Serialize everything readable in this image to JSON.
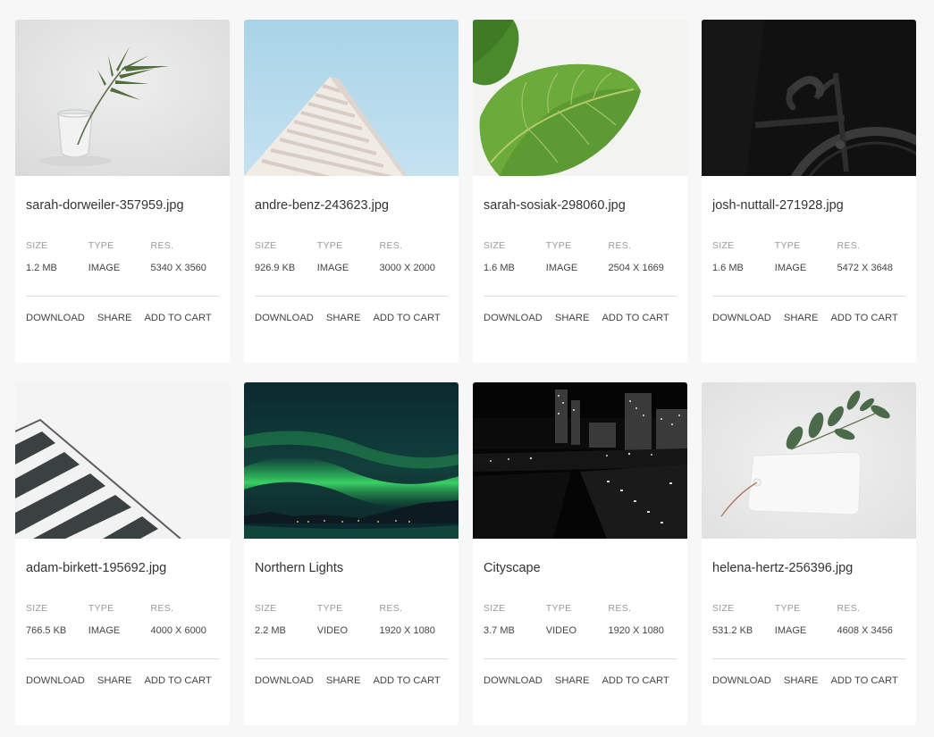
{
  "labels": {
    "size": "SIZE",
    "type": "TYPE",
    "res": "RES."
  },
  "actions": {
    "download": "DOWNLOAD",
    "share": "SHARE",
    "add_to_cart": "ADD TO CART"
  },
  "cards": [
    {
      "title": "sarah-dorweiler-357959.jpg",
      "size": "1.2 MB",
      "type": "IMAGE",
      "res": "5340 X 3560",
      "thumb": "plant-in-glass-photo"
    },
    {
      "title": "andre-benz-243623.jpg",
      "size": "926.9 KB",
      "type": "IMAGE",
      "res": "3000 X 2000",
      "thumb": "white-building-sky-photo"
    },
    {
      "title": "sarah-sosiak-298060.jpg",
      "size": "1.6 MB",
      "type": "IMAGE",
      "res": "2504 X 1669",
      "thumb": "green-leaf-photo"
    },
    {
      "title": "josh-nuttall-271928.jpg",
      "size": "1.6 MB",
      "type": "IMAGE",
      "res": "5472 X 3648",
      "thumb": "black-bicycle-photo"
    },
    {
      "title": "adam-birkett-195692.jpg",
      "size": "766.5 KB",
      "type": "IMAGE",
      "res": "4000 X 6000",
      "thumb": "striped-awning-photo"
    },
    {
      "title": "Northern Lights",
      "size": "2.2 MB",
      "type": "VIDEO",
      "res": "1920 X 1080",
      "thumb": "aurora-photo"
    },
    {
      "title": "Cityscape",
      "size": "3.7 MB",
      "type": "VIDEO",
      "res": "1920 X 1080",
      "thumb": "night-city-photo"
    },
    {
      "title": "helena-hertz-256396.jpg",
      "size": "531.2 KB",
      "type": "IMAGE",
      "res": "4608 X 3456",
      "thumb": "eucalyptus-tag-photo"
    }
  ]
}
